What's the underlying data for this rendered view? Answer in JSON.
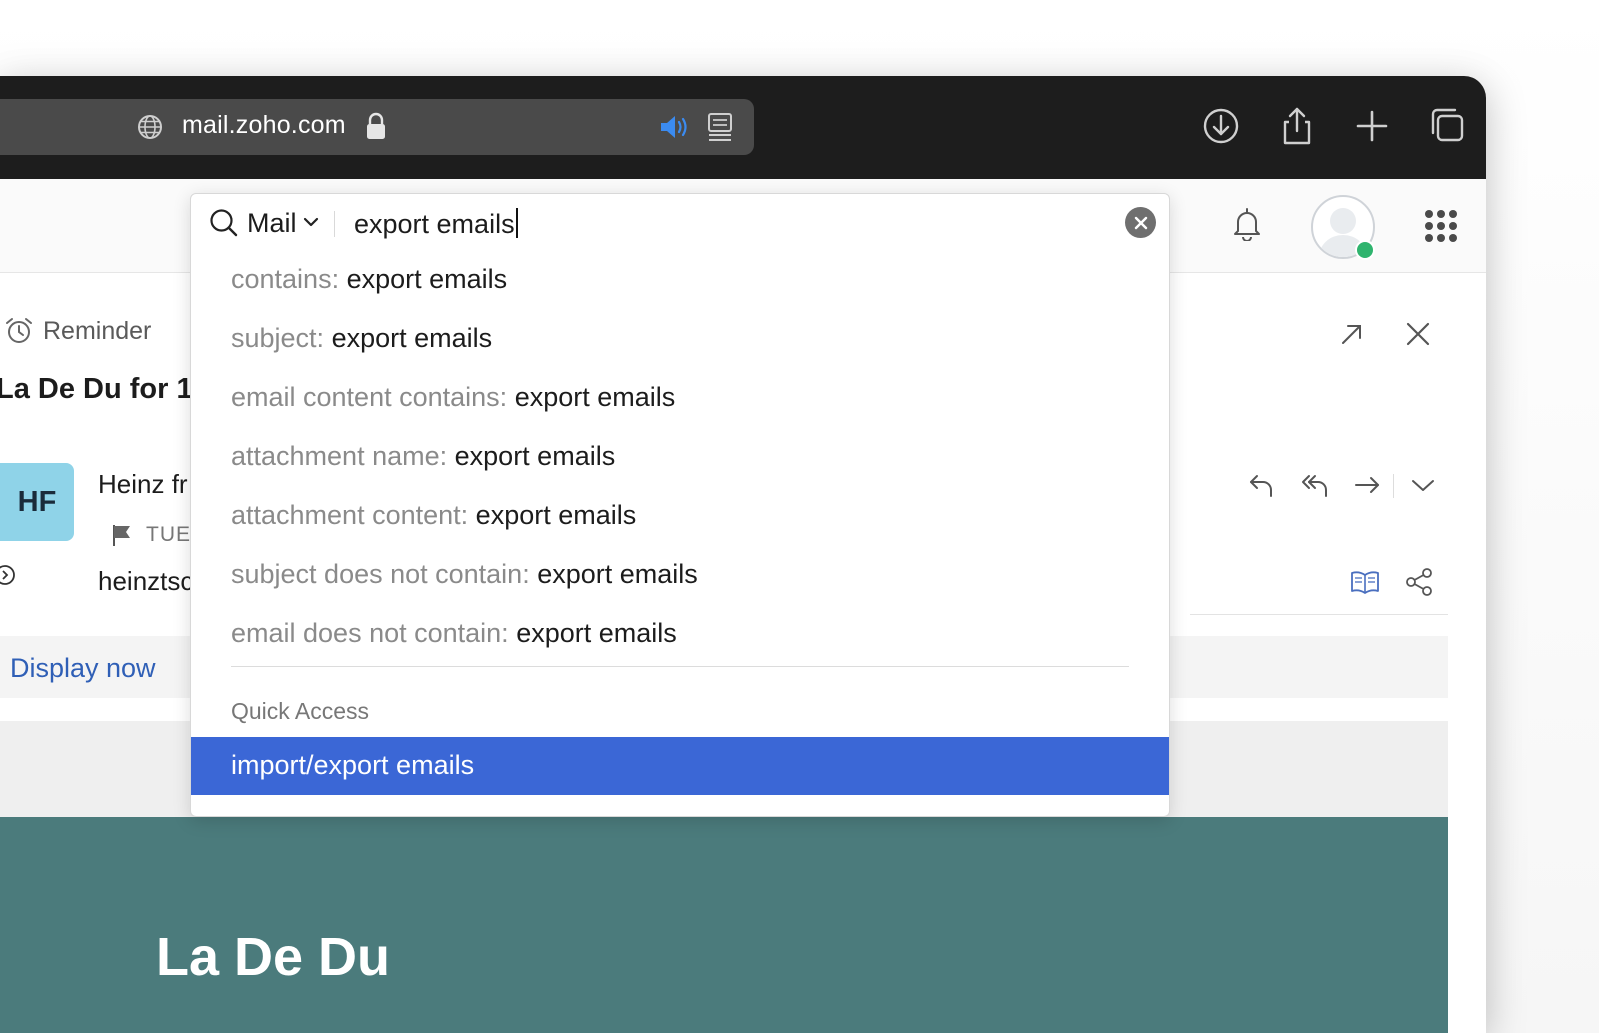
{
  "browser": {
    "url": "mail.zoho.com"
  },
  "reminder": {
    "label": "Reminder"
  },
  "mail": {
    "subject": "La De Du for 1",
    "sender_initials": "HF",
    "sender_name": "Heinz fr",
    "date": "TUE",
    "sender_email": "heinztsc",
    "display_now": "Display now",
    "body_title": "La De Du"
  },
  "search": {
    "scope": "Mail",
    "query": "export emails",
    "suggestions": [
      {
        "key": "contains:",
        "value": "export emails"
      },
      {
        "key": "subject:",
        "value": "export emails"
      },
      {
        "key": "email content contains:",
        "value": "export emails"
      },
      {
        "key": "attachment name:",
        "value": "export emails"
      },
      {
        "key": "attachment content:",
        "value": "export emails"
      },
      {
        "key": "subject does not contain:",
        "value": "export emails"
      },
      {
        "key": "email does not contain:",
        "value": "export emails"
      }
    ],
    "quick_access_heading": "Quick Access",
    "quick_access_items": [
      "import/export emails"
    ]
  },
  "colors": {
    "highlight": "#3b67d6",
    "online_status": "#2fb46e",
    "email_banner": "#4b7b7c",
    "link": "#2f5fb6"
  }
}
